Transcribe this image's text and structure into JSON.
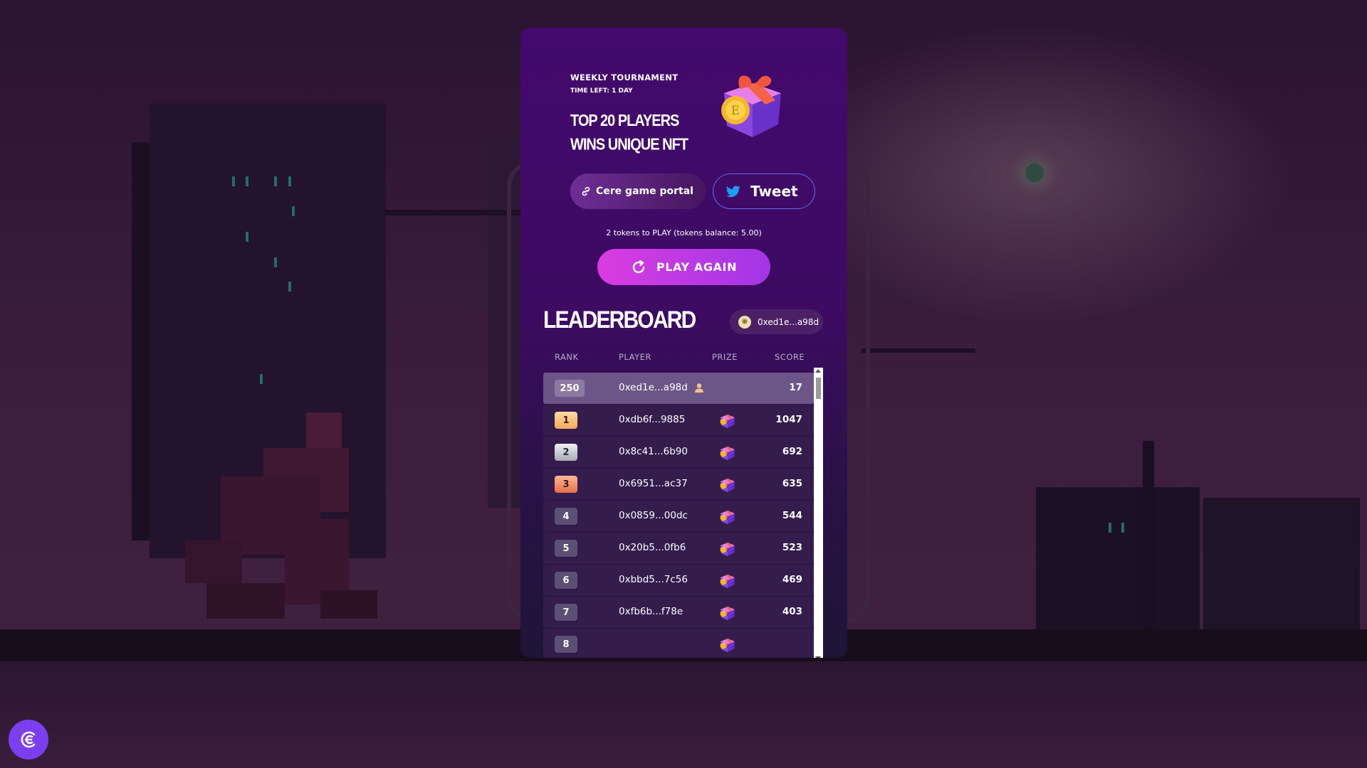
{
  "tournament": {
    "label": "WEEKLY TOURNAMENT",
    "time_left": "TIME LEFT: 1 DAY",
    "headline": "TOP 20 PLAYERS WINS UNIQUE NFT"
  },
  "actions": {
    "portal_label": "Cere game portal",
    "tweet_label": "Tweet",
    "tokens_text": "2 tokens to PLAY (tokens balance: 5.00)",
    "play_again_label": "PLAY AGAIN"
  },
  "leaderboard": {
    "title": "LEADERBOARD",
    "wallet": "0xed1e...a98d",
    "columns": {
      "rank": "RANK",
      "player": "PLAYER",
      "prize": "PRIZE",
      "score": "SCORE"
    },
    "rows": [
      {
        "rank": "250",
        "player": "0xed1e...a98d",
        "score": "17",
        "me": true,
        "prize": false
      },
      {
        "rank": "1",
        "player": "0xdb6f...9885",
        "score": "1047",
        "tier": "gold",
        "prize": true
      },
      {
        "rank": "2",
        "player": "0x8c41...6b90",
        "score": "692",
        "tier": "silver",
        "prize": true
      },
      {
        "rank": "3",
        "player": "0x6951...ac37",
        "score": "635",
        "tier": "bronze",
        "prize": true
      },
      {
        "rank": "4",
        "player": "0x0859...00dc",
        "score": "544",
        "prize": true
      },
      {
        "rank": "5",
        "player": "0x20b5...0fb6",
        "score": "523",
        "prize": true
      },
      {
        "rank": "6",
        "player": "0xbbd5...7c56",
        "score": "469",
        "prize": true
      },
      {
        "rank": "7",
        "player": "0xfb6b...f78e",
        "score": "403",
        "prize": true
      },
      {
        "rank": "8",
        "player": "",
        "score": "",
        "prize": true
      }
    ]
  },
  "icons": {
    "link": "link-icon",
    "twitter": "twitter-bird-icon",
    "refresh": "refresh-icon",
    "user": "user-icon",
    "gift": "gift-box-icon",
    "cere": "cere-logo-icon"
  },
  "colors": {
    "card_top": "#43096d",
    "play_button": "#d93de0",
    "tweet_border": "#5c6ff0",
    "twitter_blue": "#1d9bf0",
    "fab": "#7b3ff0"
  }
}
